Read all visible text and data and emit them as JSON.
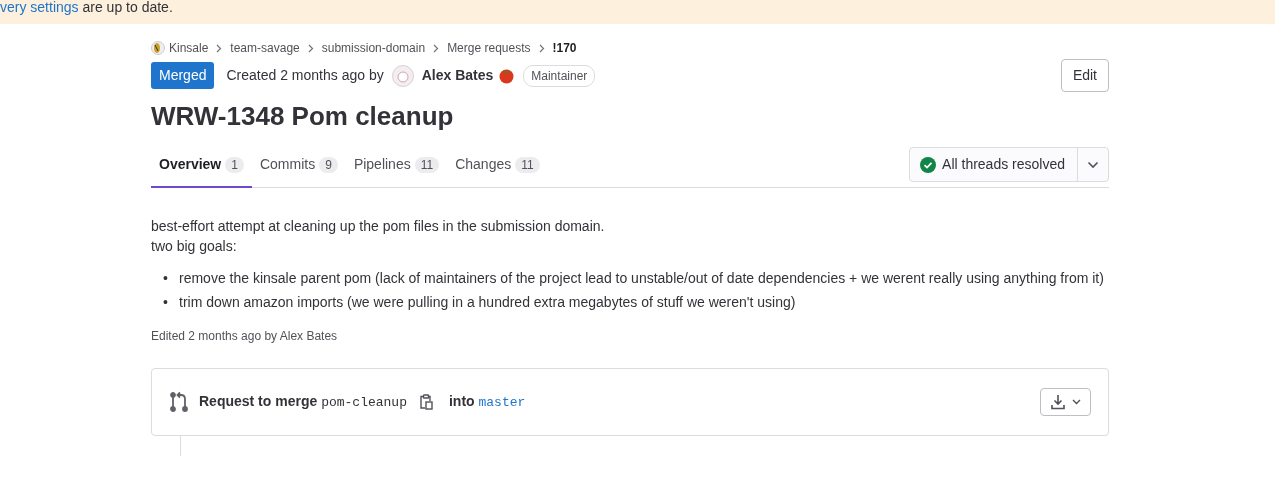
{
  "banner": {
    "link": "very settings",
    "text": " are up to date."
  },
  "breadcrumbs": [
    {
      "label": "Kinsale",
      "kind": "group"
    },
    {
      "label": "team-savage",
      "kind": "plain"
    },
    {
      "label": "submission-domain",
      "kind": "plain"
    },
    {
      "label": "Merge requests",
      "kind": "plain"
    },
    {
      "label": "!170",
      "kind": "current"
    }
  ],
  "header": {
    "status": "Merged",
    "created": "Created 2 months ago by",
    "author": "Alex Bates",
    "role": "Maintainer",
    "edit_button": "Edit"
  },
  "title": "WRW-1348 Pom cleanup",
  "tabs": [
    {
      "label": "Overview",
      "count": "1",
      "selected": true
    },
    {
      "label": "Commits",
      "count": "9",
      "selected": false
    },
    {
      "label": "Pipelines",
      "count": "11",
      "selected": false
    },
    {
      "label": "Changes",
      "count": "11",
      "selected": false
    }
  ],
  "threads": {
    "label": "All threads resolved",
    "resolved": true
  },
  "description": {
    "lines": [
      "best-effort attempt at cleaning up the pom files in the submission domain.",
      "two big goals:"
    ],
    "bullets": [
      {
        "marker": "•",
        "text": "remove the kinsale parent pom (lack of maintainers of the project lead to unstable/out of date dependencies + we werent really using anything from it)"
      },
      {
        "marker": "•",
        "text": "trim down amazon imports (we were pulling in a hundred extra megabytes of stuff we weren't using)"
      }
    ],
    "edited": "Edited 2 months ago by Alex Bates"
  },
  "merge_widget": {
    "label": "Request to merge",
    "source": "pom-cleanup",
    "into": "into",
    "target": "master"
  }
}
